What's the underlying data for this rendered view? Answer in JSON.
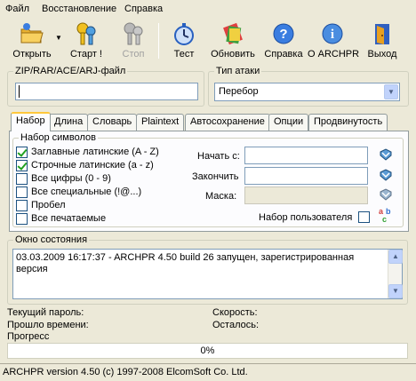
{
  "menu": [
    "Файл",
    "Восстановление",
    "Справка"
  ],
  "toolbar": {
    "open": "Открыть",
    "start": "Старт !",
    "stop": "Стоп",
    "test": "Тест",
    "update": "Обновить",
    "help": "Справка",
    "about": "О ARCHPR",
    "exit": "Выход"
  },
  "file_group": {
    "label": "ZIP/RAR/ACE/ARJ-файл",
    "value": ""
  },
  "attack_group": {
    "label": "Тип атаки",
    "selected": "Перебор"
  },
  "tabs": [
    "Набор",
    "Длина",
    "Словарь",
    "Plaintext",
    "Автосохранение",
    "Опции",
    "Продвинутость"
  ],
  "charset": {
    "label": "Набор символов",
    "options": [
      {
        "label": "Заглавные латинские (A - Z)",
        "checked": true
      },
      {
        "label": "Строчные латинские (a - z)",
        "checked": true
      },
      {
        "label": "Все цифры (0 - 9)",
        "checked": false
      },
      {
        "label": "Все специальные (!@...)",
        "checked": false
      },
      {
        "label": "Пробел",
        "checked": false
      },
      {
        "label": "Все печатаемые",
        "checked": false
      }
    ],
    "start_label": "Начать с:",
    "end_label": "Закончить",
    "mask_label": "Маска:",
    "user_charset_label": "Набор пользователя"
  },
  "status_window": {
    "label": "Окно состояния",
    "log": "03.03.2009 16:17:37 - ARCHPR 4.50 build 26 запущен, зарегистрированная версия"
  },
  "info": {
    "current_password": "Текущий пароль:",
    "elapsed": "Прошло времени:",
    "progress_label": "Прогресс",
    "speed": "Скорость:",
    "remaining": "Осталось:"
  },
  "progress": {
    "value": 0,
    "text": "0%"
  },
  "statusbar": "ARCHPR version 4.50 (c) 1997-2008 ElcomSoft Co. Ltd."
}
